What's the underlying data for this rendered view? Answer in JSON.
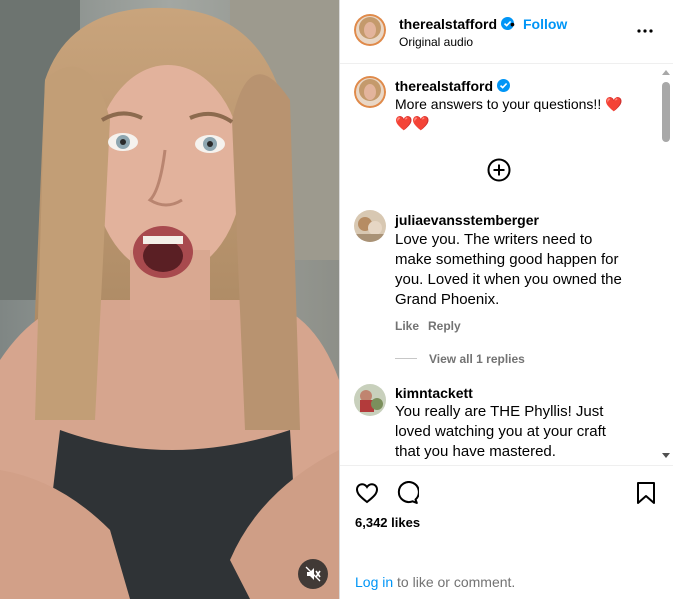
{
  "post": {
    "username": "therealstafford",
    "follow_label": "Follow",
    "separator": "•",
    "audio_label": "Original audio",
    "more_icon": "more-horizontal-icon"
  },
  "caption": {
    "username": "therealstafford",
    "text": "More answers to your questions!! ❤️",
    "text2": "❤️❤️"
  },
  "load_more_icon": "plus-circle-icon",
  "comments": [
    {
      "username": "juliaevansstemberger",
      "lines": [
        "Love you. The writers need to",
        "make something good happen for",
        "you. Loved it when you owned the",
        "Grand Phoenix."
      ],
      "like_label": "Like",
      "reply_label": "Reply",
      "view_replies": "View all 1 replies"
    },
    {
      "username": "kimntackett",
      "lines": [
        "You really are THE Phyllis! Just",
        "loved watching you at your craft",
        "that you have mastered."
      ]
    }
  ],
  "actions": {
    "likes": "6,342 likes",
    "login_link": "Log in",
    "login_rest": " to like or comment."
  },
  "colors": {
    "link": "#0095f6",
    "verified": "#0095f6",
    "heart": "#ed1c24"
  }
}
